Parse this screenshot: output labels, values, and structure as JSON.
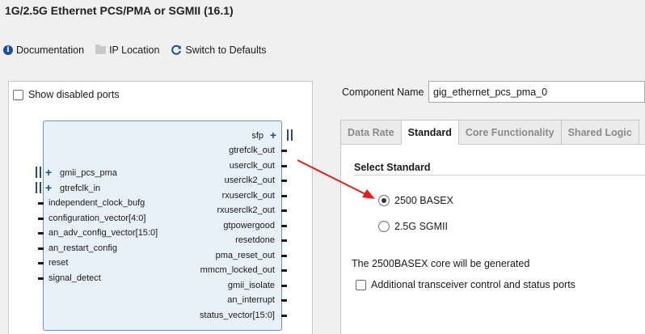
{
  "window": {
    "title": "1G/2.5G Ethernet PCS/PMA or SGMII (16.1)"
  },
  "toolbar": {
    "documentation_label": "Documentation",
    "ip_location_label": "IP Location",
    "switch_defaults_label": "Switch to Defaults"
  },
  "symbol": {
    "show_disabled_label": "Show disabled ports",
    "left_ports": [
      "gmii_pcs_pma",
      "gtrefclk_in",
      "independent_clock_bufg",
      "configuration_vector[4:0]",
      "an_adv_config_vector[15:0]",
      "an_restart_config",
      "reset",
      "signal_detect"
    ],
    "right_ports": [
      "sfp",
      "gtrefclk_out",
      "userclk_out",
      "userclk2_out",
      "rxuserclk_out",
      "rxuserclk2_out",
      "gtpowergood",
      "resetdone",
      "pma_reset_out",
      "mmcm_locked_out",
      "gmii_isolate",
      "an_interrupt",
      "status_vector[15:0]"
    ]
  },
  "component": {
    "label": "Component Name",
    "value": "gig_ethernet_pcs_pma_0"
  },
  "tabs": [
    {
      "label": "Data Rate",
      "active": false
    },
    {
      "label": "Standard",
      "active": true
    },
    {
      "label": "Core Functionality",
      "active": false
    },
    {
      "label": "Shared Logic",
      "active": false
    }
  ],
  "standard": {
    "section_title": "Select Standard",
    "options": [
      {
        "label": "2500 BASEX",
        "selected": true
      },
      {
        "label": "2.5G SGMII",
        "selected": false
      }
    ],
    "info_text": "The 2500BASEX core will be generated",
    "extra_ports_label": "Additional transceiver control and status ports"
  },
  "colors": {
    "accent": "#1f4e8f",
    "annotation_arrow": "#e02020",
    "block_fill": "#e8f1fa"
  }
}
